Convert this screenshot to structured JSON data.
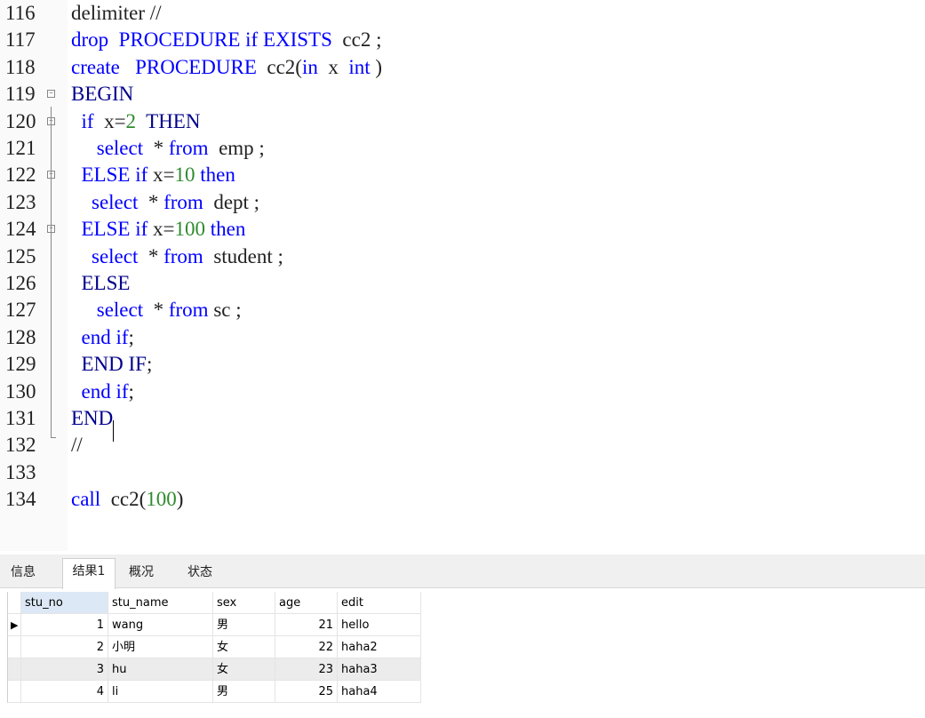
{
  "editor": {
    "lines": [
      {
        "num": "116",
        "tokens": [
          {
            "t": "delimiter //",
            "c": "plain"
          }
        ]
      },
      {
        "num": "117",
        "tokens": [
          {
            "t": "drop  PROCEDURE if EXISTS",
            "c": "kw"
          },
          {
            "t": "  cc2 ;",
            "c": "plain"
          }
        ]
      },
      {
        "num": "118",
        "tokens": [
          {
            "t": "create   PROCEDURE",
            "c": "kw"
          },
          {
            "t": "  cc2(",
            "c": "plain"
          },
          {
            "t": "in",
            "c": "kw"
          },
          {
            "t": "  x  ",
            "c": "plain"
          },
          {
            "t": "int",
            "c": "kw"
          },
          {
            "t": " )",
            "c": "plain"
          }
        ]
      },
      {
        "num": "119",
        "tokens": [
          {
            "t": "BEGIN",
            "c": "kwd"
          }
        ]
      },
      {
        "num": "120",
        "tokens": [
          {
            "t": "  ",
            "c": "plain"
          },
          {
            "t": "if",
            "c": "kw"
          },
          {
            "t": "  x=",
            "c": "plain"
          },
          {
            "t": "2",
            "c": "num"
          },
          {
            "t": "  ",
            "c": "plain"
          },
          {
            "t": "THEN",
            "c": "kwd"
          }
        ]
      },
      {
        "num": "121",
        "tokens": [
          {
            "t": "     ",
            "c": "plain"
          },
          {
            "t": "select",
            "c": "kw"
          },
          {
            "t": "  * ",
            "c": "plain"
          },
          {
            "t": "from",
            "c": "kw"
          },
          {
            "t": "  emp ;",
            "c": "plain"
          }
        ]
      },
      {
        "num": "122",
        "tokens": [
          {
            "t": "  ",
            "c": "plain"
          },
          {
            "t": "ELSE if",
            "c": "kw"
          },
          {
            "t": " x=",
            "c": "plain"
          },
          {
            "t": "10",
            "c": "num"
          },
          {
            "t": " ",
            "c": "plain"
          },
          {
            "t": "then",
            "c": "kw"
          }
        ]
      },
      {
        "num": "123",
        "tokens": [
          {
            "t": "    ",
            "c": "plain"
          },
          {
            "t": "select",
            "c": "kw"
          },
          {
            "t": "  * ",
            "c": "plain"
          },
          {
            "t": "from",
            "c": "kw"
          },
          {
            "t": "  dept ;",
            "c": "plain"
          }
        ]
      },
      {
        "num": "124",
        "tokens": [
          {
            "t": "  ",
            "c": "plain"
          },
          {
            "t": "ELSE if",
            "c": "kw"
          },
          {
            "t": " x=",
            "c": "plain"
          },
          {
            "t": "100",
            "c": "num"
          },
          {
            "t": " ",
            "c": "plain"
          },
          {
            "t": "then",
            "c": "kw"
          }
        ]
      },
      {
        "num": "125",
        "tokens": [
          {
            "t": "    ",
            "c": "plain"
          },
          {
            "t": "select",
            "c": "kw"
          },
          {
            "t": "  * ",
            "c": "plain"
          },
          {
            "t": "from",
            "c": "kw"
          },
          {
            "t": "  student ;",
            "c": "plain"
          }
        ]
      },
      {
        "num": "126",
        "tokens": [
          {
            "t": "  ",
            "c": "plain"
          },
          {
            "t": "ELSE",
            "c": "kwd"
          }
        ]
      },
      {
        "num": "127",
        "tokens": [
          {
            "t": "     ",
            "c": "plain"
          },
          {
            "t": "select",
            "c": "kw"
          },
          {
            "t": "  * ",
            "c": "plain"
          },
          {
            "t": "from",
            "c": "kw"
          },
          {
            "t": " sc ;",
            "c": "plain"
          }
        ]
      },
      {
        "num": "128",
        "tokens": [
          {
            "t": "  ",
            "c": "plain"
          },
          {
            "t": "end if",
            "c": "kw"
          },
          {
            "t": ";",
            "c": "plain"
          }
        ]
      },
      {
        "num": "129",
        "tokens": [
          {
            "t": "  ",
            "c": "plain"
          },
          {
            "t": "END IF",
            "c": "kwd"
          },
          {
            "t": ";",
            "c": "plain"
          }
        ]
      },
      {
        "num": "130",
        "tokens": [
          {
            "t": "  ",
            "c": "plain"
          },
          {
            "t": "end if",
            "c": "kw"
          },
          {
            "t": ";",
            "c": "plain"
          }
        ]
      },
      {
        "num": "131",
        "tokens": [
          {
            "t": "END",
            "c": "kwd"
          }
        ]
      },
      {
        "num": "132",
        "tokens": [
          {
            "t": "//",
            "c": "plain"
          }
        ]
      },
      {
        "num": "133",
        "tokens": []
      },
      {
        "num": "134",
        "tokens": [
          {
            "t": "call",
            "c": "kw"
          },
          {
            "t": "  cc2(",
            "c": "plain"
          },
          {
            "t": "100",
            "c": "num"
          },
          {
            "t": ")",
            "c": "plain"
          }
        ]
      }
    ],
    "fold_markers": [
      "119",
      "120",
      "122",
      "124"
    ],
    "colors": {
      "keyword": "#0000ff",
      "keyword_dark": "#00008b",
      "number": "#2e8b2e",
      "text": "#222222"
    }
  },
  "tabs": [
    {
      "label": "信息",
      "active": false
    },
    {
      "label": "结果1",
      "active": true
    },
    {
      "label": "概况",
      "active": false
    },
    {
      "label": "状态",
      "active": false
    }
  ],
  "grid": {
    "columns": [
      "stu_no",
      "stu_name",
      "sex",
      "age",
      "edit"
    ],
    "rows": [
      [
        "1",
        "wang",
        "男",
        "21",
        "hello"
      ],
      [
        "2",
        "小明",
        "女",
        "22",
        "haha2"
      ],
      [
        "3",
        "hu",
        "女",
        "23",
        "haha3"
      ],
      [
        "4",
        "li",
        "男",
        "25",
        "haha4"
      ]
    ],
    "current_row_marker": "▶"
  }
}
